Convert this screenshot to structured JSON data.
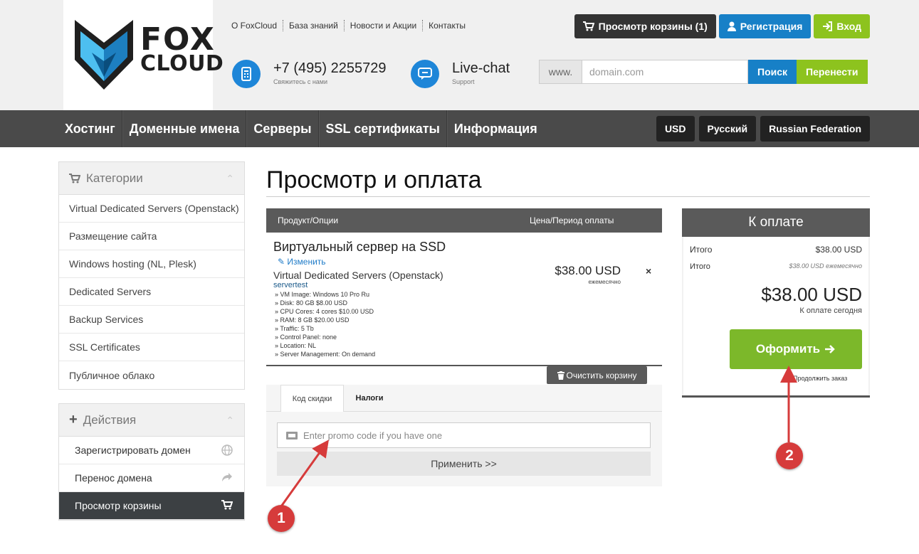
{
  "brand": {
    "line1": "FOX",
    "line2": "CLOUD"
  },
  "top_links": [
    "О FoxCloud",
    "База знаний",
    "Новости и Акции",
    "Контакты"
  ],
  "top_buttons": {
    "cart": "Просмотр корзины (1)",
    "register": "Регистрация",
    "login": "Вход"
  },
  "contact": {
    "phone": "+7 (495) 2255729",
    "phone_sub": "Свяжитесь с нами",
    "chat": "Live-chat",
    "chat_sub": "Support"
  },
  "domain_form": {
    "prefix": "www.",
    "placeholder": "domain.com",
    "search": "Поиск",
    "transfer": "Перенести"
  },
  "nav": {
    "items": [
      "Хостинг",
      "Доменные имена",
      "Серверы",
      "SSL сертификаты",
      "Информация"
    ],
    "currency": "USD",
    "language": "Русский",
    "country": "Russian Federation"
  },
  "sidebar": {
    "categories_title": "Категории",
    "categories": [
      "Virtual Dedicated Servers (Openstack)",
      "Размещение сайта",
      "Windows hosting (NL, Plesk)",
      "Dedicated Servers",
      "Backup Services",
      "SSL Certificates",
      "Публичное облако"
    ],
    "actions_title": "Действия",
    "actions": [
      "Зарегистрировать домен",
      "Перенос домена",
      "Просмотр корзины"
    ]
  },
  "main": {
    "title": "Просмотр и оплата",
    "cart_head": {
      "product": "Продукт/Опции",
      "price": "Цена/Период оплаты"
    },
    "item": {
      "name": "Виртуальный сервер на SSD",
      "edit": "Изменить",
      "group": "Virtual Dedicated Servers (Openstack)",
      "hostname": "servertest",
      "options": [
        "» VM Image: Windows 10 Pro Ru",
        "» Disk: 80 GB $8.00 USD",
        "» CPU Cores: 4 cores $10.00 USD",
        "» RAM: 8 GB $20.00 USD",
        "» Traffic: 5 Tb",
        "» Control Panel: none",
        "» Location: NL",
        "» Server Management: On demand"
      ],
      "price": "$38.00 USD",
      "period": "ежемесячно",
      "remove": "×"
    },
    "clear_cart": "Очистить корзину",
    "tabs": [
      "Код скидки",
      "Налоги"
    ],
    "promo_placeholder": "Enter promo code if you have one",
    "apply": "Применить >>"
  },
  "summary": {
    "title": "К оплате",
    "subtotal_label": "Итого",
    "subtotal": "$38.00 USD",
    "recurring_label": "Итого",
    "recurring": "$38.00 USD ежемесячно",
    "total": "$38.00 USD",
    "due_today": "К оплате сегодня",
    "checkout": "Оформить",
    "continue": "Продолжить заказ"
  },
  "annotations": {
    "marker1": "1",
    "marker2": "2",
    "color": "#d63b3b"
  },
  "colors": {
    "blue": "#1780c7",
    "green": "#8dc31e",
    "dark": "#333333",
    "nav": "#4a4a4a"
  }
}
